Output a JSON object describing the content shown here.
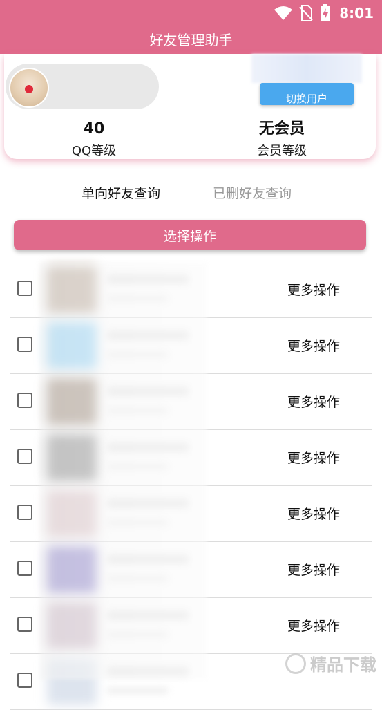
{
  "status_bar": {
    "time": "8:01"
  },
  "app_bar": {
    "title": "好友管理助手"
  },
  "profile": {
    "switch_button_label": "切换用户",
    "stats": [
      {
        "value": "40",
        "label": "QQ等级"
      },
      {
        "value": "无会员",
        "label": "会员等级"
      }
    ]
  },
  "tabs": {
    "active": "单向好友查询",
    "inactive": "已删好友查询"
  },
  "action": {
    "label": "选择操作"
  },
  "friends": {
    "more_label": "更多操作",
    "avatar_colors": [
      "#b9a898",
      "#8fd0f4",
      "#9a8878",
      "#8a8a8a",
      "#d9c0c4",
      "#8a80c8",
      "#c8b4c2",
      "#dde4ee"
    ]
  },
  "watermark": {
    "text": "精品下载"
  }
}
